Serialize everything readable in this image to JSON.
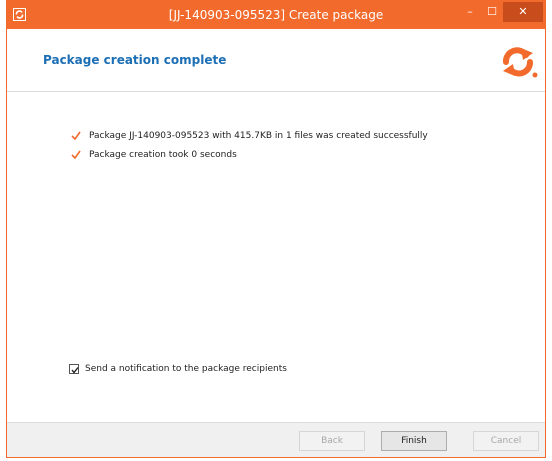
{
  "window": {
    "title": "[JJ-140903-095523] Create package",
    "controls": {
      "minimize": "–",
      "maximize": "☐",
      "close": "✕"
    },
    "accent_color": "#f26b2d"
  },
  "header": {
    "title": "Package creation complete",
    "title_color": "#1d6fb5",
    "logo_icon": "sync-arrows-logo"
  },
  "messages": [
    {
      "icon": "check-icon",
      "text": "Package JJ-140903-095523 with 415.7KB in 1 files was created successfully"
    },
    {
      "icon": "check-icon",
      "text": "Package creation took 0 seconds"
    }
  ],
  "notification": {
    "label": "Send a notification to the package recipients",
    "checked": true
  },
  "footer": {
    "back_label": "Back",
    "finish_label": "Finish",
    "cancel_label": "Cancel"
  }
}
